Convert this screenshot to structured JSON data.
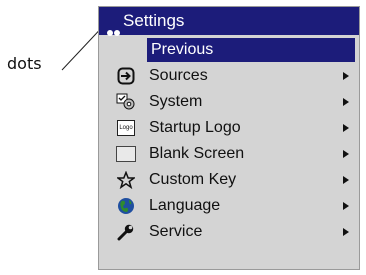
{
  "callout": {
    "label": "dots"
  },
  "menu": {
    "title": "Settings",
    "items": [
      {
        "label": "Previous",
        "icon": "none",
        "submenu": false,
        "selected": true
      },
      {
        "label": "Sources",
        "icon": "sources-icon",
        "submenu": true
      },
      {
        "label": "System",
        "icon": "system-icon",
        "submenu": true
      },
      {
        "label": "Startup Logo",
        "icon": "logo-icon",
        "icon_text": "Logo",
        "submenu": true
      },
      {
        "label": "Blank Screen",
        "icon": "blank-screen-icon",
        "submenu": true
      },
      {
        "label": "Custom Key",
        "icon": "star-icon",
        "submenu": true
      },
      {
        "label": "Language",
        "icon": "globe-icon",
        "submenu": true
      },
      {
        "label": "Service",
        "icon": "wrench-icon",
        "submenu": true
      }
    ]
  },
  "colors": {
    "title_bg": "#1c1c7a",
    "menu_bg": "#d4d4d4",
    "text": "#111111"
  }
}
